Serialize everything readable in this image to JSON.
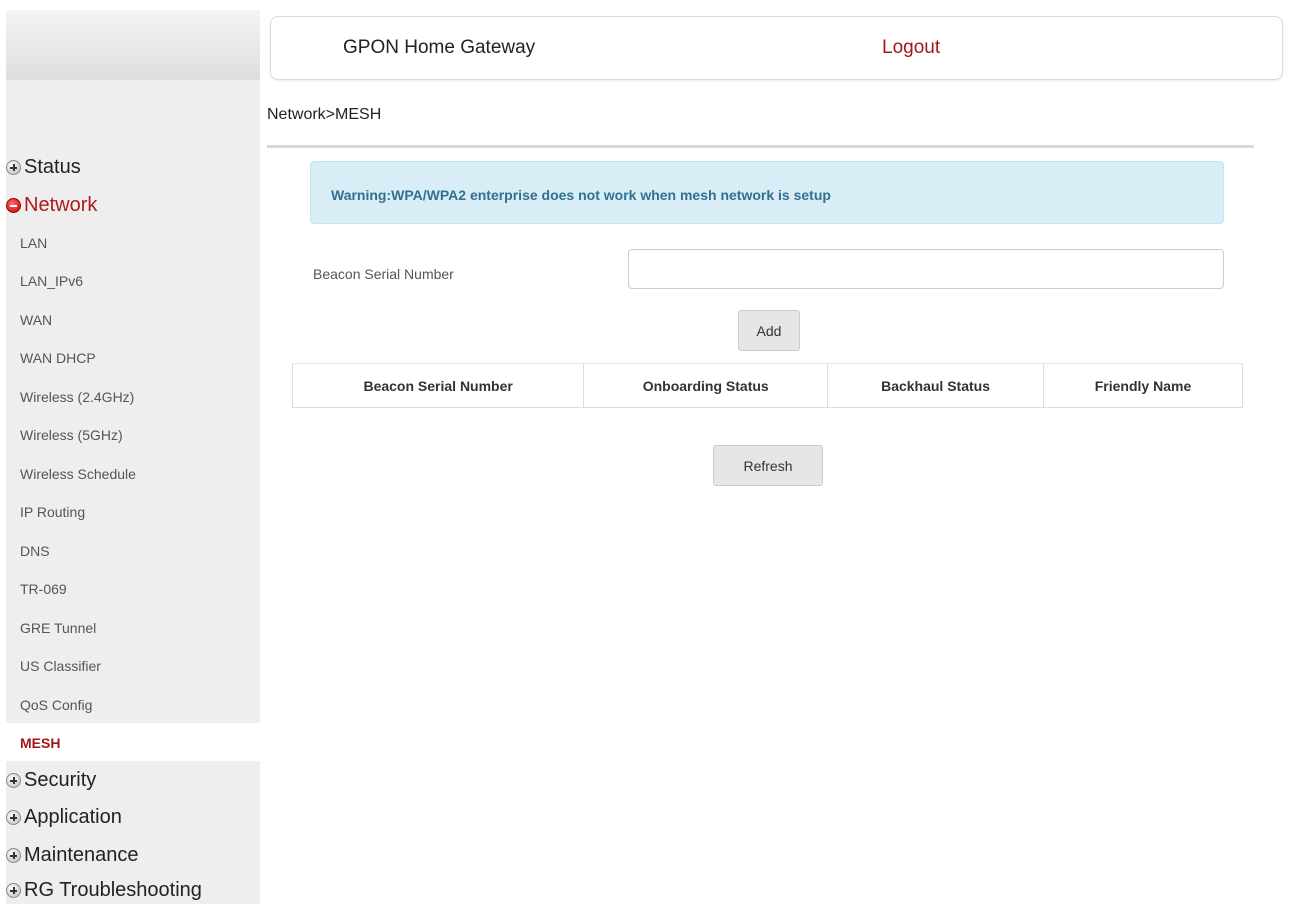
{
  "header": {
    "title": "GPON Home Gateway",
    "logout": "Logout"
  },
  "breadcrumb": "Network>MESH",
  "sidebar": {
    "groups": [
      {
        "label": "Status",
        "expanded": false
      },
      {
        "label": "Network",
        "expanded": true
      },
      {
        "label": "Security",
        "expanded": false
      },
      {
        "label": "Application",
        "expanded": false
      },
      {
        "label": "Maintenance",
        "expanded": false
      },
      {
        "label": "RG Troubleshooting",
        "expanded": false
      }
    ],
    "network_items": [
      "LAN",
      "LAN_IPv6",
      "WAN",
      "WAN DHCP",
      "Wireless (2.4GHz)",
      "Wireless (5GHz)",
      "Wireless Schedule",
      "IP Routing",
      "DNS",
      "TR-069",
      "GRE Tunnel",
      "US Classifier",
      "QoS Config",
      "MESH"
    ],
    "active_item": "MESH"
  },
  "warning": "Warning:WPA/WPA2 enterprise does not work when mesh network is setup",
  "form": {
    "label": "Beacon Serial Number",
    "value": "",
    "placeholder": "",
    "add_button": "Add"
  },
  "table": {
    "columns": [
      "Beacon Serial Number",
      "Onboarding Status",
      "Backhaul Status",
      "Friendly Name"
    ],
    "rows": []
  },
  "refresh_button": "Refresh",
  "colors": {
    "accent_red": "#a11818",
    "warning_bg": "#d9edf7",
    "warning_text": "#31708f",
    "sidebar_bg": "#eeeeee"
  }
}
